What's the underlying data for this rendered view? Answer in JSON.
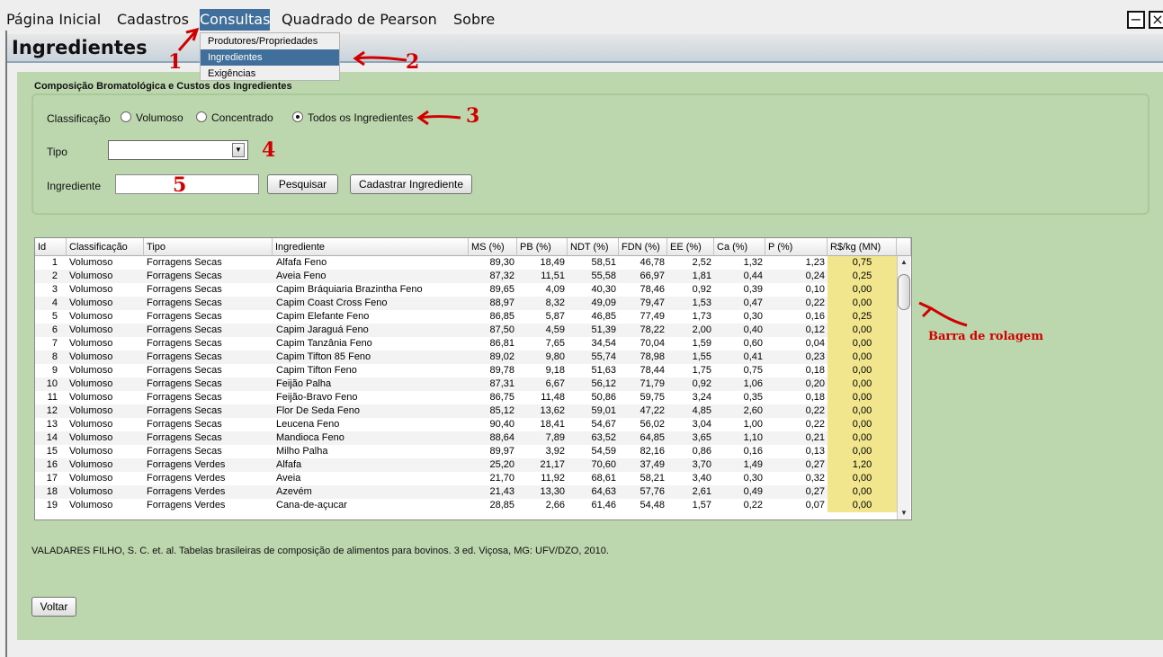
{
  "menubar": {
    "items": [
      "Página Inicial",
      "Cadastros",
      "Consultas",
      "Quadrado de Pearson",
      "Sobre"
    ],
    "active": "Consultas",
    "dropdown": [
      "Produtores/Propriedades",
      "Ingredientes",
      "Exigências"
    ],
    "dropdown_selected": "Ingredientes",
    "minimize_glyph": "−",
    "close_glyph": "×"
  },
  "window": {
    "title": "Ingredientes",
    "group_title": "Composição Bromatológica e Custos dos Ingredientes"
  },
  "filters": {
    "classificacao_label": "Classificação",
    "options": [
      "Volumoso",
      "Concentrado",
      "Todos os Ingredientes"
    ],
    "selected_option": "Todos os Ingredientes",
    "tipo_label": "Tipo",
    "tipo_value": "",
    "ingrediente_label": "Ingrediente",
    "ingrediente_value": "",
    "search_button": "Pesquisar",
    "register_button": "Cadastrar Ingrediente"
  },
  "annotations": [
    "1",
    "2",
    "3",
    "4",
    "5",
    "Barra de rolagem"
  ],
  "table": {
    "columns": [
      "Id",
      "Classificação",
      "Tipo",
      "Ingrediente",
      "MS (%)",
      "PB (%)",
      "NDT (%)",
      "FDN (%)",
      "EE (%)",
      "Ca (%)",
      "P (%)",
      "R$/kg (MN)"
    ],
    "rows": [
      [
        "1",
        "Volumoso",
        "Forragens Secas",
        "Alfafa Feno",
        "89,30",
        "18,49",
        "58,51",
        "46,78",
        "2,52",
        "1,32",
        "1,23",
        "0,75"
      ],
      [
        "2",
        "Volumoso",
        "Forragens Secas",
        "Aveia Feno",
        "87,32",
        "11,51",
        "55,58",
        "66,97",
        "1,81",
        "0,44",
        "0,24",
        "0,25"
      ],
      [
        "3",
        "Volumoso",
        "Forragens Secas",
        "Capim Bráquiaria Brazintha Feno",
        "89,65",
        "4,09",
        "40,30",
        "78,46",
        "0,92",
        "0,39",
        "0,10",
        "0,00"
      ],
      [
        "4",
        "Volumoso",
        "Forragens Secas",
        "Capim Coast Cross Feno",
        "88,97",
        "8,32",
        "49,09",
        "79,47",
        "1,53",
        "0,47",
        "0,22",
        "0,00"
      ],
      [
        "5",
        "Volumoso",
        "Forragens Secas",
        "Capim Elefante Feno",
        "86,85",
        "5,87",
        "46,85",
        "77,49",
        "1,73",
        "0,30",
        "0,16",
        "0,25"
      ],
      [
        "6",
        "Volumoso",
        "Forragens Secas",
        "Capim Jaraguá Feno",
        "87,50",
        "4,59",
        "51,39",
        "78,22",
        "2,00",
        "0,40",
        "0,12",
        "0,00"
      ],
      [
        "7",
        "Volumoso",
        "Forragens Secas",
        "Capim Tanzânia Feno",
        "86,81",
        "7,65",
        "34,54",
        "70,04",
        "1,59",
        "0,60",
        "0,04",
        "0,00"
      ],
      [
        "8",
        "Volumoso",
        "Forragens Secas",
        "Capim Tifton 85 Feno",
        "89,02",
        "9,80",
        "55,74",
        "78,98",
        "1,55",
        "0,41",
        "0,23",
        "0,00"
      ],
      [
        "9",
        "Volumoso",
        "Forragens Secas",
        "Capim Tifton Feno",
        "89,78",
        "9,18",
        "51,63",
        "78,44",
        "1,75",
        "0,75",
        "0,18",
        "0,00"
      ],
      [
        "10",
        "Volumoso",
        "Forragens Secas",
        "Feijão Palha",
        "87,31",
        "6,67",
        "56,12",
        "71,79",
        "0,92",
        "1,06",
        "0,20",
        "0,00"
      ],
      [
        "11",
        "Volumoso",
        "Forragens Secas",
        "Feijão-Bravo Feno",
        "86,75",
        "11,48",
        "50,86",
        "59,75",
        "3,24",
        "0,35",
        "0,18",
        "0,00"
      ],
      [
        "12",
        "Volumoso",
        "Forragens Secas",
        "Flor De Seda Feno",
        "85,12",
        "13,62",
        "59,01",
        "47,22",
        "4,85",
        "2,60",
        "0,22",
        "0,00"
      ],
      [
        "13",
        "Volumoso",
        "Forragens Secas",
        "Leucena Feno",
        "90,40",
        "18,41",
        "54,67",
        "56,02",
        "3,04",
        "1,00",
        "0,22",
        "0,00"
      ],
      [
        "14",
        "Volumoso",
        "Forragens Secas",
        "Mandioca Feno",
        "88,64",
        "7,89",
        "63,52",
        "64,85",
        "3,65",
        "1,10",
        "0,21",
        "0,00"
      ],
      [
        "15",
        "Volumoso",
        "Forragens Secas",
        "Milho Palha",
        "89,97",
        "3,92",
        "54,59",
        "82,16",
        "0,86",
        "0,16",
        "0,13",
        "0,00"
      ],
      [
        "16",
        "Volumoso",
        "Forragens Verdes",
        "Alfafa",
        "25,20",
        "21,17",
        "70,60",
        "37,49",
        "3,70",
        "1,49",
        "0,27",
        "1,20"
      ],
      [
        "17",
        "Volumoso",
        "Forragens Verdes",
        "Aveia",
        "21,70",
        "11,92",
        "68,61",
        "58,21",
        "3,40",
        "0,30",
        "0,32",
        "0,00"
      ],
      [
        "18",
        "Volumoso",
        "Forragens Verdes",
        "Azevém",
        "21,43",
        "13,30",
        "64,63",
        "57,76",
        "2,61",
        "0,49",
        "0,27",
        "0,00"
      ],
      [
        "19",
        "Volumoso",
        "Forragens Verdes",
        "Cana-de-açucar",
        "28,85",
        "2,66",
        "61,46",
        "54,48",
        "1,57",
        "0,22",
        "0,07",
        "0,00"
      ]
    ]
  },
  "reference": "VALADARES FILHO, S. C. et. al. Tabelas brasileiras de composição de alimentos para bovinos. 3 ed. Viçosa, MG: UFV/DZO, 2010.",
  "back_button": "Voltar"
}
